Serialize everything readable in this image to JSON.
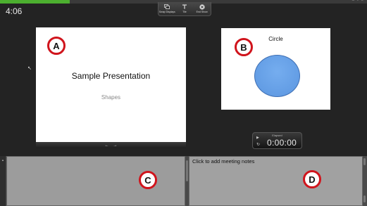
{
  "clock": "4:06",
  "presentation_progress": 0.19,
  "toolbar": {
    "buttons": [
      {
        "label": "Swap Displays",
        "icon": "swap-displays-icon"
      },
      {
        "label": "Tile",
        "icon": "tile-icon"
      },
      {
        "label": "End Show",
        "icon": "close-icon"
      }
    ]
  },
  "current_slide": {
    "title": "Sample Presentation",
    "subtitle": "Shapes",
    "prev_arrow": "←",
    "next_arrow": "→"
  },
  "next_slide": {
    "title": "Circle",
    "shape_color": "#5b96e0"
  },
  "timer": {
    "label": "Elapsed",
    "value": "0:00:00"
  },
  "notes": {
    "placeholder": "Click to add meeting notes"
  },
  "callouts": {
    "a": "A",
    "b": "B",
    "c": "C",
    "d": "D"
  },
  "colors": {
    "background": "#232323",
    "progress": "#4caf2f",
    "callout_border": "#d0141c"
  }
}
